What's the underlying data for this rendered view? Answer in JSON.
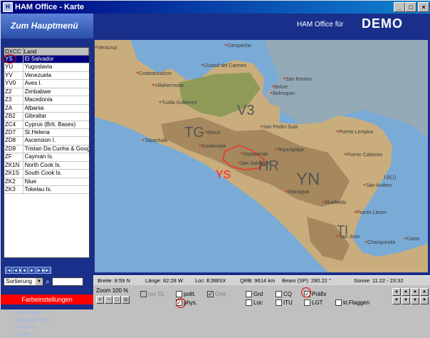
{
  "window": {
    "title": "HAM Office - Karte",
    "minimize": "_",
    "maximize": "□",
    "close": "×"
  },
  "header": {
    "menu_label": "Zum Hauptmenü",
    "owner_prefix": "HAM Office für",
    "owner_name": "DEMO"
  },
  "table": {
    "columns": [
      "DXCC",
      "Land"
    ],
    "rows": [
      [
        "YS",
        "El Salvador"
      ],
      [
        "YU",
        "Yugoslavia"
      ],
      [
        "YV",
        "Venezuela"
      ],
      [
        "YV0",
        "Aves I."
      ],
      [
        "Z2",
        "Zimbabwe"
      ],
      [
        "Z3",
        "Macedonia"
      ],
      [
        "ZA",
        "Albania"
      ],
      [
        "ZB2",
        "Gibraltar"
      ],
      [
        "ZC4",
        "Cyprus (Brit. Bases)"
      ],
      [
        "ZD7",
        "St.Helena"
      ],
      [
        "ZD8",
        "Ascension I."
      ],
      [
        "ZD9",
        "Tristan Da Cunha & Goug"
      ],
      [
        "ZF",
        "Cayman Is."
      ],
      [
        "ZK1N",
        "North Cook Is."
      ],
      [
        "ZK1S",
        "South Cook Is."
      ],
      [
        "ZK2",
        "Niue"
      ],
      [
        "ZK3",
        "Tokelau Is."
      ]
    ],
    "selected_index": 0
  },
  "nav_icons": [
    "first-icon",
    "prev-page-icon",
    "prev-icon",
    "next-icon",
    "next-page-icon",
    "last-icon"
  ],
  "nav_glyphs": [
    "|◄",
    "◄◄",
    "◄",
    "►",
    "►►",
    "►|"
  ],
  "sort": {
    "label": "Sortierung",
    "search_icon": "binoculars-icon"
  },
  "color_button": "Farbeinstellungen",
  "copyright": [
    "HAM Office",
    "Copyright 2002",
    "ARcomm",
    "GmbH"
  ],
  "map": {
    "cities": [
      "Veracruz",
      "Campeche",
      "Ciudad del Carmen",
      "Coatzacoalcos",
      "Villahermosa",
      "Tuxtla Gutierrez",
      "San Pedro Sula",
      "Belize",
      "Belmopan",
      "San Roman",
      "Tapachula",
      "Mixco",
      "Guatemala",
      "Tegucigalpa",
      "Soyapango",
      "San Salvador",
      "Puerto Lempira",
      "Puerto Cabezas",
      "Managua",
      "Bluefields",
      "San Andres",
      "Puerto Limon",
      "San Jose",
      "Chanquinola",
      "Colon"
    ],
    "prefix_labels": [
      "V3",
      "TG",
      "HR",
      "YS",
      "YN",
      "TI",
      "HK0"
    ],
    "highlight_color": "#ff2020",
    "ocean_color": "#7aaad6",
    "land_color": "#c9ad7d"
  },
  "status": {
    "breite": "Breite: 8:59 N",
    "laenge": "Länge: 82:28 W",
    "loc": "Loc: EJ88SX",
    "qrb": "QRB: 9614 km",
    "beam": "Beam (SP): 280.22 °",
    "sonne": "Sonne: 11:22 - 23:32"
  },
  "controls": {
    "zoom_label": "Zoom",
    "zoom_value": "100 %",
    "zoom_icons": [
      "zoom-in-icon",
      "zoom-out-icon",
      "zoom-rect-icon",
      "zoom-globe-icon"
    ],
    "zoom_glyphs": [
      "+",
      "−",
      "□",
      "◎"
    ],
    "checkboxes": [
      {
        "label": "nur DL",
        "checked": false,
        "disabled": true
      },
      {
        "label": "polit.",
        "checked": false,
        "disabled": false
      },
      {
        "label": "Orte",
        "checked": true,
        "disabled": true
      },
      {
        "label": "phys.",
        "checked": true,
        "disabled": false
      },
      {
        "label": "Grd",
        "checked": false,
        "disabled": false
      },
      {
        "label": "Loc",
        "checked": false,
        "disabled": false
      },
      {
        "label": "CQ",
        "checked": false,
        "disabled": false
      },
      {
        "label": "ITU",
        "checked": false,
        "disabled": false
      },
      {
        "label": "Präfix",
        "checked": true,
        "disabled": false
      },
      {
        "label": "LGT",
        "checked": false,
        "disabled": false
      },
      {
        "label": "kl.Flaggen",
        "checked": false,
        "disabled": false
      }
    ],
    "pan_glyphs": [
      "▲",
      "▲",
      "▲",
      "▲",
      "▼",
      "▼",
      "▼",
      "▼"
    ]
  }
}
